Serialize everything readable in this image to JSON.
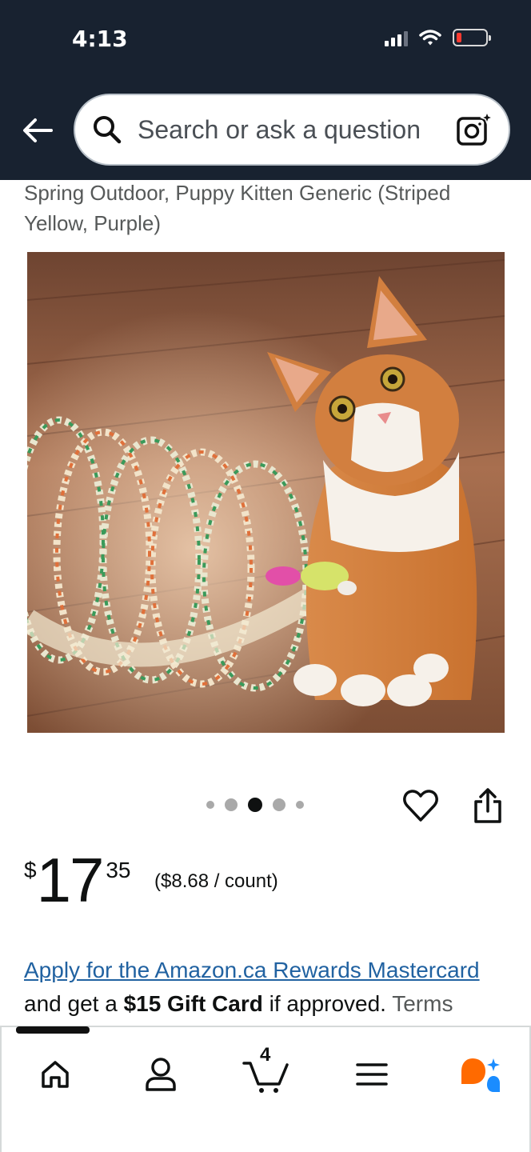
{
  "status_bar": {
    "time": "4:13"
  },
  "header": {
    "search_placeholder": "Search or ask a question",
    "icons": [
      "back-arrow-icon",
      "search-icon",
      "camera-icon"
    ]
  },
  "product": {
    "title": "Spring Outdoor, Puppy Kitten Generic (Striped Yellow, Purple)",
    "image_description": "orange-white cat beside striped collapsible tunnel with toy mouse",
    "image_count": 5,
    "active_image": 3,
    "price": {
      "symbol": "$",
      "whole": "17",
      "fraction": "35"
    },
    "unit_price": "($8.68 / count)"
  },
  "promo": {
    "link_text": "Apply for the Amazon.ca Rewards Mastercard",
    "prefix": "and get a ",
    "bold": "$15 Gift Card",
    "suffix": " if approved. ",
    "terms": "Terms"
  },
  "bottom_nav": {
    "items": [
      "home-icon",
      "account-icon",
      "cart-icon",
      "menu-icon",
      "rufus-icon"
    ],
    "cart_count": "4"
  },
  "colors": {
    "header_bg": "#182230",
    "link": "#2162a1",
    "battery_low": "#ff3b30"
  }
}
